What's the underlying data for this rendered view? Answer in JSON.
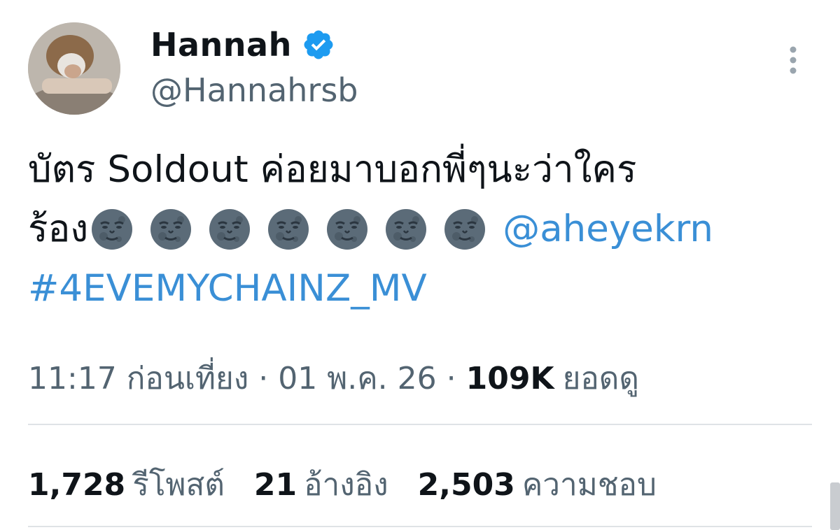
{
  "author": {
    "name": "Hannah",
    "handle": "@Hannahrsb",
    "verified": true
  },
  "tweet": {
    "line1": "บัตร Soldout ค่อยมาบอกพี่ๆนะว่าใคร",
    "line2_prefix": "ร้อง",
    "emoji": "new-moon-with-face",
    "emoji_count": 7,
    "mention": "@aheyekrn",
    "hashtag": "#4EVEMYCHAINZ_MV"
  },
  "meta": {
    "time": "11:17 ก่อนเที่ยง",
    "separator": "·",
    "date": "01 พ.ค. 26",
    "views_count": "109K",
    "views_label": "ยอดดู"
  },
  "stats": {
    "reposts_count": "1,728",
    "reposts_label": "รีโพสต์",
    "quotes_count": "21",
    "quotes_label": "อ้างอิง",
    "likes_count": "2,503",
    "likes_label": "ความชอบ"
  },
  "colors": {
    "link": "#3a8fd6",
    "verified": "#1d9bf0",
    "secondary_text": "#536471",
    "divider": "#dfe3e6"
  }
}
